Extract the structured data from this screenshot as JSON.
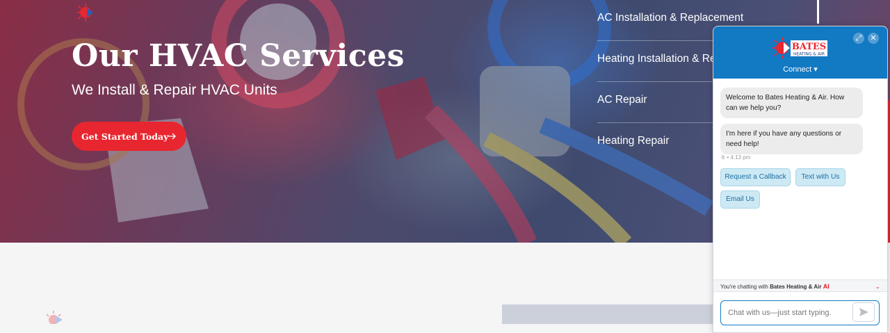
{
  "hero": {
    "title": "Our HVAC Services",
    "subtitle": "We Install & Repair HVAC Units",
    "cta_label": "Get Started Today",
    "cta_icon": "arrow-right-icon"
  },
  "services": {
    "items": [
      {
        "label": "AC Installation & Replacement"
      },
      {
        "label": "Heating Installation & Replacement"
      },
      {
        "label": "AC Repair"
      },
      {
        "label": "Heating Repair"
      }
    ]
  },
  "chat": {
    "brand_line1": "BATES",
    "brand_line2": "HEATING & AIR",
    "connect_label": "Connect",
    "messages": [
      {
        "text": "Welcome to Bates Heating & Air. How can we help you?"
      },
      {
        "text": "I'm here if you have any questions or need help!"
      }
    ],
    "timestamp": "4:13 pm",
    "quick_replies": [
      {
        "label": "Request a Callback"
      },
      {
        "label": "Text with Us"
      },
      {
        "label": "Email Us"
      }
    ],
    "chatting_prefix": "You're chatting with",
    "chatting_name": "Bates Heating & Air",
    "ai_badge": "AI",
    "input_placeholder": "Chat with us—just start typing."
  },
  "colors": {
    "brand_red": "#e8262f",
    "chat_blue": "#1279c3",
    "quick_reply_bg": "#cde9f4"
  }
}
